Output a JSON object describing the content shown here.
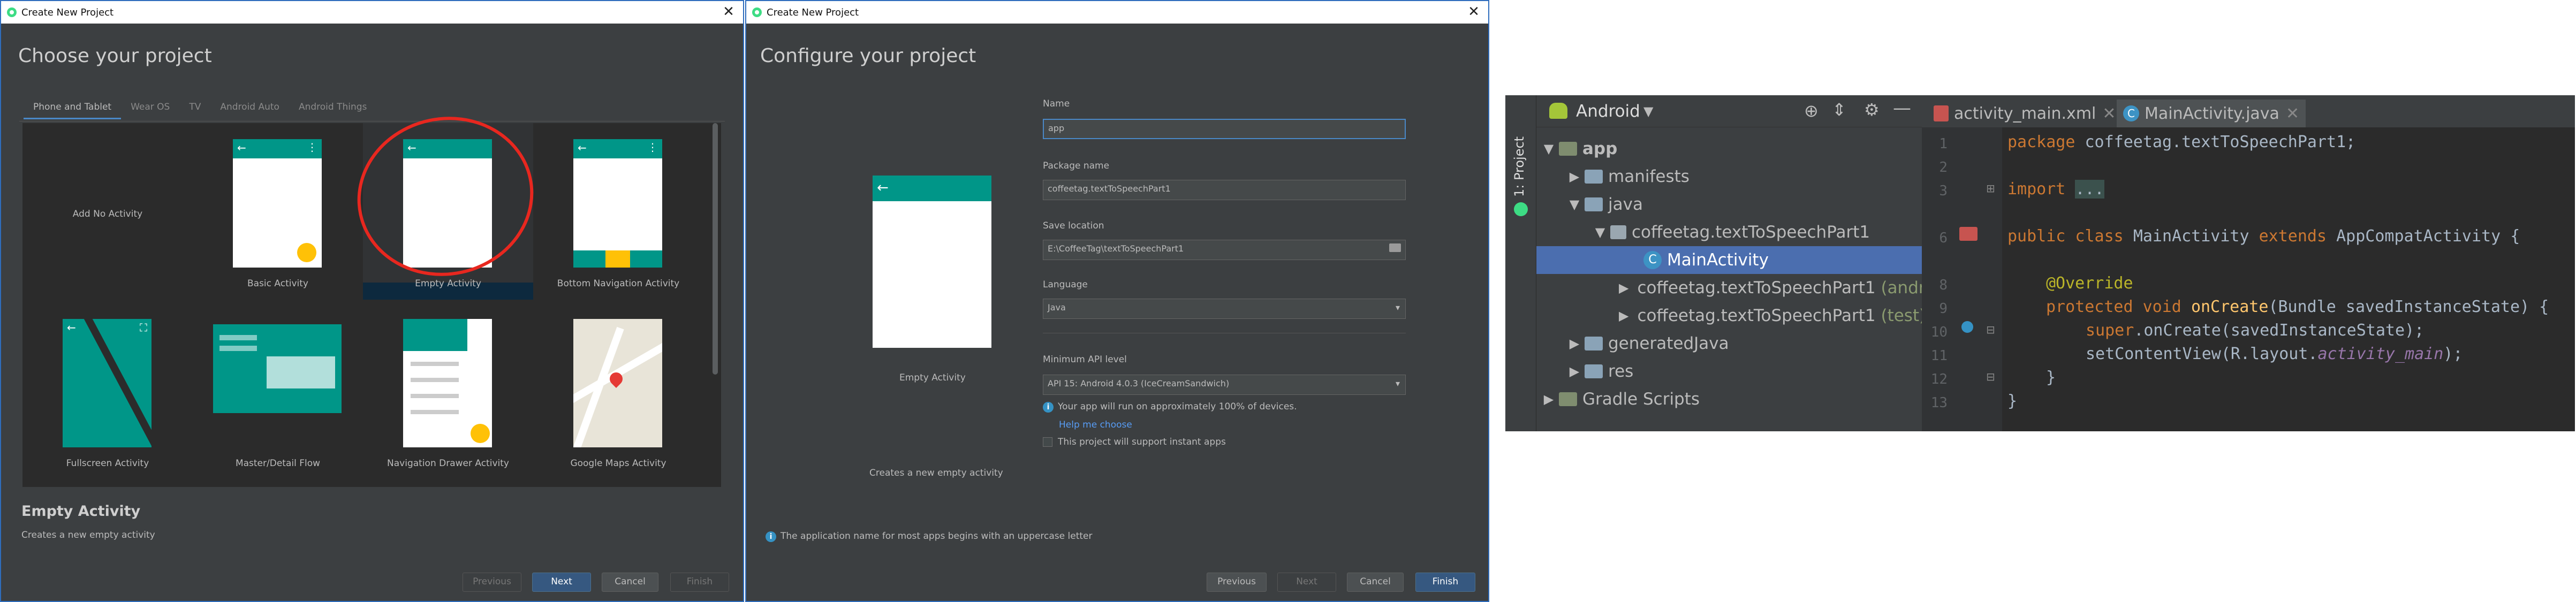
{
  "wizard1": {
    "title": "Create New Project",
    "heading": "Choose your project",
    "tabs": [
      "Phone and Tablet",
      "Wear OS",
      "TV",
      "Android Auto",
      "Android Things"
    ],
    "templates": [
      "Add No Activity",
      "Basic Activity",
      "Empty Activity",
      "Bottom Navigation Activity",
      "Fullscreen Activity",
      "Master/Detail Flow",
      "Navigation Drawer Activity",
      "Google Maps Activity"
    ],
    "desc_title": "Empty Activity",
    "desc_text": "Creates a new empty activity",
    "buttons": {
      "previous": "Previous",
      "next": "Next",
      "cancel": "Cancel",
      "finish": "Finish"
    }
  },
  "wizard2": {
    "title": "Create New Project",
    "heading": "Configure your project",
    "preview_label": "Empty Activity",
    "preview_desc": "Creates a new empty activity",
    "name_label": "Name",
    "name_value": "app",
    "package_label": "Package name",
    "package_value": "coffeetag.textToSpeechPart1",
    "location_label": "Save location",
    "location_value": "E:\\CoffeeTag\\textToSpeechPart1",
    "language_label": "Language",
    "language_value": "Java",
    "minapi_label": "Minimum API level",
    "minapi_value": "API 15: Android 4.0.3 (IceCreamSandwich)",
    "info_run": "Your app will run on approximately 100% of devices.",
    "help": "Help me choose",
    "instant": "This project will support instant apps",
    "warning": "The application name for most apps begins with an uppercase letter",
    "buttons": {
      "previous": "Previous",
      "next": "Next",
      "cancel": "Cancel",
      "finish": "Finish"
    }
  },
  "ide": {
    "side_tab": "1: Project",
    "view_mode": "Android",
    "tree": [
      "app",
      "manifests",
      "java",
      "coffeetag.textToSpeechPart1",
      "MainActivity",
      "coffeetag.textToSpeechPart1",
      "(androidTest)",
      "coffeetag.textToSpeechPart1",
      "(test)",
      "generatedJava",
      "res",
      "Gradle Scripts"
    ],
    "tabs": [
      "activity_main.xml",
      "MainActivity.java"
    ],
    "line_numbers": [
      "1",
      "2",
      "3",
      "",
      "6",
      "",
      "8",
      "9",
      "10",
      "11",
      "12",
      "13"
    ],
    "code": {
      "l1a": "package ",
      "l1b": "coffeetag.textToSpeechPart1;",
      "l3a": "import ",
      "l3b": "...",
      "l6a": "public class ",
      "l6b": "MainActivity ",
      "l6c": "extends ",
      "l6d": "AppCompatActivity {",
      "l8": "@Override",
      "l9a": "protected void ",
      "l9b": "onCreate",
      "l9c": "(Bundle savedInstanceState) {",
      "l10a": "super",
      "l10b": ".onCreate(savedInstanceState);",
      "l11a": "setContentView(R.layout.",
      "l11b": "activity_main",
      "l11c": ");",
      "l12": "}",
      "l13": "}"
    }
  },
  "colors": {
    "accent": "#4a88c7",
    "teal": "#009688",
    "selection": "#4b6eaf",
    "annotation_circle": "#e8271f"
  }
}
